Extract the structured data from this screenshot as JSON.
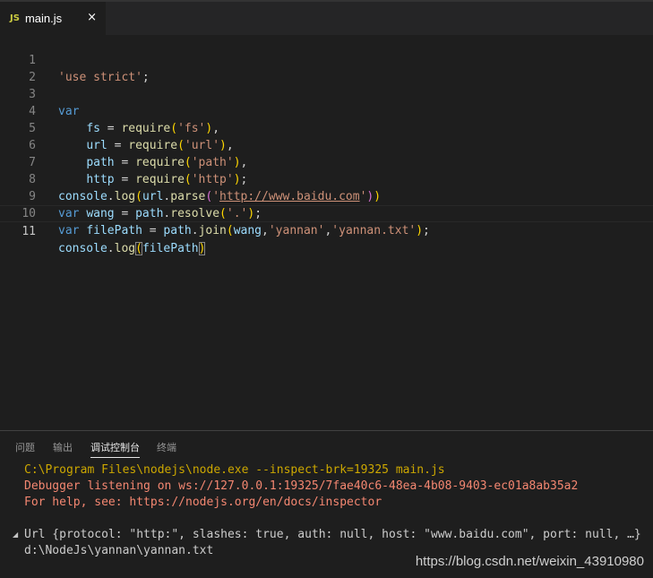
{
  "tab": {
    "icon_text": "JS",
    "label": "main.js",
    "close_glyph": "×"
  },
  "editor": {
    "lines": [
      {
        "number": "1",
        "text": "'use strict';"
      },
      {
        "number": "2",
        "text": ""
      },
      {
        "number": "3",
        "text": "var"
      },
      {
        "number": "4",
        "text": "    fs = require('fs'),"
      },
      {
        "number": "5",
        "text": "    url = require('url'),"
      },
      {
        "number": "6",
        "text": "    path = require('path'),"
      },
      {
        "number": "7",
        "text": "    http = require('http');"
      },
      {
        "number": "8",
        "text": "console.log(url.parse('http://www.baidu.com'))"
      },
      {
        "number": "9",
        "text": "var wang = path.resolve('.');"
      },
      {
        "number": "10",
        "text": "var filePath = path.join(wang,'yannan','yannan.txt');"
      },
      {
        "number": "11",
        "text": "console.log(filePath)"
      }
    ],
    "active_line": "11"
  },
  "panel": {
    "tabs": [
      {
        "label": "问题"
      },
      {
        "label": "输出"
      },
      {
        "label": "调试控制台"
      },
      {
        "label": "终端"
      }
    ],
    "active_tab": "调试控制台",
    "console": {
      "cmd": "C:\\Program Files\\nodejs\\node.exe --inspect-brk=19325 main.js",
      "debugger": "Debugger listening on ws://127.0.0.1:19325/7fae40c6-48ea-4b08-9403-ec01a8ab35a2",
      "help": "For help, see: https://nodejs.org/en/docs/inspector",
      "url_obj": "Url {protocol: \"http:\", slashes: true, auth: null, host: \"www.baidu.com\", port: null, …}",
      "path_out": "d:\\NodeJs\\yannan\\yannan.txt"
    }
  },
  "watermark": "https://blog.csdn.net/weixin_43910980",
  "colors": {
    "background": "#1e1e1e",
    "keyword": "#569cd6",
    "string": "#ce9178",
    "variable": "#9cdcfe",
    "function": "#dcdcaa",
    "console_orange": "#cca700",
    "console_red": "#f48771"
  }
}
